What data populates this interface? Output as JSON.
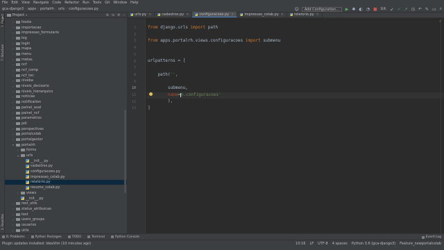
{
  "menu": [
    "File",
    "Edit",
    "View",
    "Navigate",
    "Code",
    "Refactor",
    "Run",
    "Tools",
    "Git",
    "Window",
    "Help"
  ],
  "breadcrumbs": [
    "gca-django3",
    "apps",
    "portalrh",
    "urls",
    "configuracoes.py"
  ],
  "toolbar": {
    "add_configuration": "Add Configuration...",
    "git_label": "Git:",
    "run_icon": "play-icon",
    "stop_icon": "stop-icon"
  },
  "project_panel": {
    "title": "Project",
    "tree": [
      {
        "label": "hoote",
        "depth": 1,
        "type": "folder",
        "expanded": false
      },
      {
        "label": "importacao",
        "depth": 1,
        "type": "folder",
        "expanded": false
      },
      {
        "label": "impressao_formulario",
        "depth": 1,
        "type": "folder",
        "expanded": false
      },
      {
        "label": "log",
        "depth": 1,
        "type": "folder",
        "expanded": false
      },
      {
        "label": "login",
        "depth": 1,
        "type": "folder",
        "expanded": false
      },
      {
        "label": "mapa",
        "depth": 1,
        "type": "folder",
        "expanded": false
      },
      {
        "label": "menu",
        "depth": 1,
        "type": "folder",
        "expanded": false
      },
      {
        "label": "metas",
        "depth": 1,
        "type": "folder",
        "expanded": false
      },
      {
        "label": "ncf",
        "depth": 1,
        "type": "folder",
        "expanded": false
      },
      {
        "label": "ncf_comp",
        "depth": 1,
        "type": "folder",
        "expanded": false
      },
      {
        "label": "ncf_tec",
        "depth": 1,
        "type": "folder",
        "expanded": false
      },
      {
        "label": "niveba",
        "depth": 1,
        "type": "folder",
        "expanded": false
      },
      {
        "label": "niveis_decisorio",
        "depth": 1,
        "type": "folder",
        "expanded": false
      },
      {
        "label": "niveis_hierarquico",
        "depth": 1,
        "type": "folder",
        "expanded": false
      },
      {
        "label": "noticias",
        "depth": 1,
        "type": "folder",
        "expanded": false
      },
      {
        "label": "notification",
        "depth": 1,
        "type": "folder",
        "expanded": false
      },
      {
        "label": "painel_aval",
        "depth": 1,
        "type": "folder",
        "expanded": false
      },
      {
        "label": "painel_ncf",
        "depth": 1,
        "type": "folder",
        "expanded": false
      },
      {
        "label": "parametros",
        "depth": 1,
        "type": "folder",
        "expanded": false
      },
      {
        "label": "pdi",
        "depth": 1,
        "type": "folder",
        "expanded": false
      },
      {
        "label": "perspectivas",
        "depth": 1,
        "type": "folder",
        "expanded": false
      },
      {
        "label": "portalcolab",
        "depth": 1,
        "type": "folder",
        "expanded": false
      },
      {
        "label": "portalgestor",
        "depth": 1,
        "type": "folder",
        "expanded": false
      },
      {
        "label": "portalrh",
        "depth": 1,
        "type": "folder",
        "expanded": true
      },
      {
        "label": "forms",
        "depth": 2,
        "type": "folder",
        "expanded": false
      },
      {
        "label": "urls",
        "depth": 2,
        "type": "folder",
        "expanded": true
      },
      {
        "label": "__init__.py",
        "depth": 3,
        "type": "py"
      },
      {
        "label": "cadastros.py",
        "depth": 3,
        "type": "py"
      },
      {
        "label": "configuracoes.py",
        "depth": 3,
        "type": "py"
      },
      {
        "label": "impressao_colab.py",
        "depth": 3,
        "type": "py"
      },
      {
        "label": "relatorio.py",
        "depth": 3,
        "type": "py",
        "selected": true
      },
      {
        "label": "resumo_colab.py",
        "depth": 3,
        "type": "py"
      },
      {
        "label": "views",
        "depth": 2,
        "type": "folder",
        "expanded": false
      },
      {
        "label": "__init__.py",
        "depth": 2,
        "type": "py"
      },
      {
        "label": "rest_utils",
        "depth": 1,
        "type": "folder",
        "expanded": false
      },
      {
        "label": "status_atribuicao",
        "depth": 1,
        "type": "folder",
        "expanded": false
      },
      {
        "label": "test",
        "depth": 1,
        "type": "folder",
        "expanded": false
      },
      {
        "label": "users_groups",
        "depth": 1,
        "type": "folder",
        "expanded": false
      },
      {
        "label": "usuarios",
        "depth": 1,
        "type": "folder",
        "expanded": false
      },
      {
        "label": "utils",
        "depth": 1,
        "type": "folder",
        "expanded": false
      }
    ]
  },
  "side_tabs": {
    "project": "1: Project",
    "structure": "7: Structure",
    "favorites": "2: Favorites"
  },
  "editor_tabs": [
    {
      "label": "urls.py",
      "active": false
    },
    {
      "label": "cadastros.py",
      "active": false
    },
    {
      "label": "configuracoes.py",
      "active": true
    },
    {
      "label": "impressao_colab.py",
      "active": false
    },
    {
      "label": "relatorio.py",
      "active": false
    }
  ],
  "editor": {
    "current_line": 10,
    "line_numbers": [
      "1",
      "2",
      "3",
      "4",
      "5",
      "6",
      "7",
      "8",
      "9",
      "10",
      "11",
      "12",
      "13"
    ]
  },
  "code": {
    "l1_from": "from",
    "l1_mod": " django.urls ",
    "l1_import": "import",
    "l1_name": " path",
    "l3_from": "from",
    "l3_mod": " apps.portalrh.views.configuracoes ",
    "l3_import": "import",
    "l3_name": " submenu",
    "l6": "urlpatterns = [",
    "l8_a": "    path(",
    "l8_str": "''",
    "l8_b": ",",
    "l9": "        submenu,",
    "l10_indent": "        ",
    "l10_param": "name",
    "l10_eq": "=",
    "l10_a": "n",
    "l10_str": ".configuracoes'",
    "l11": "        ),",
    "l12": "]"
  },
  "bottom_tools": [
    "6: Problems",
    "Python Packages",
    "TODO",
    "Terminal",
    "Python Console"
  ],
  "event_log": "Event Log",
  "status": {
    "message": "Plugin updates installed: IdeaVim (10 minutes ago)",
    "position": "10:16",
    "line_sep": "LF",
    "encoding": "UTF-8",
    "indent": "4 spaces",
    "interpreter": "Python 3.6 (gca-django3)",
    "branch": "Feature_newportalcolab"
  },
  "colors": {
    "accent": "#4a88c7",
    "keyword": "#cc7832",
    "string": "#6a8759",
    "param": "#aa4926",
    "selection": "#0d293e"
  }
}
